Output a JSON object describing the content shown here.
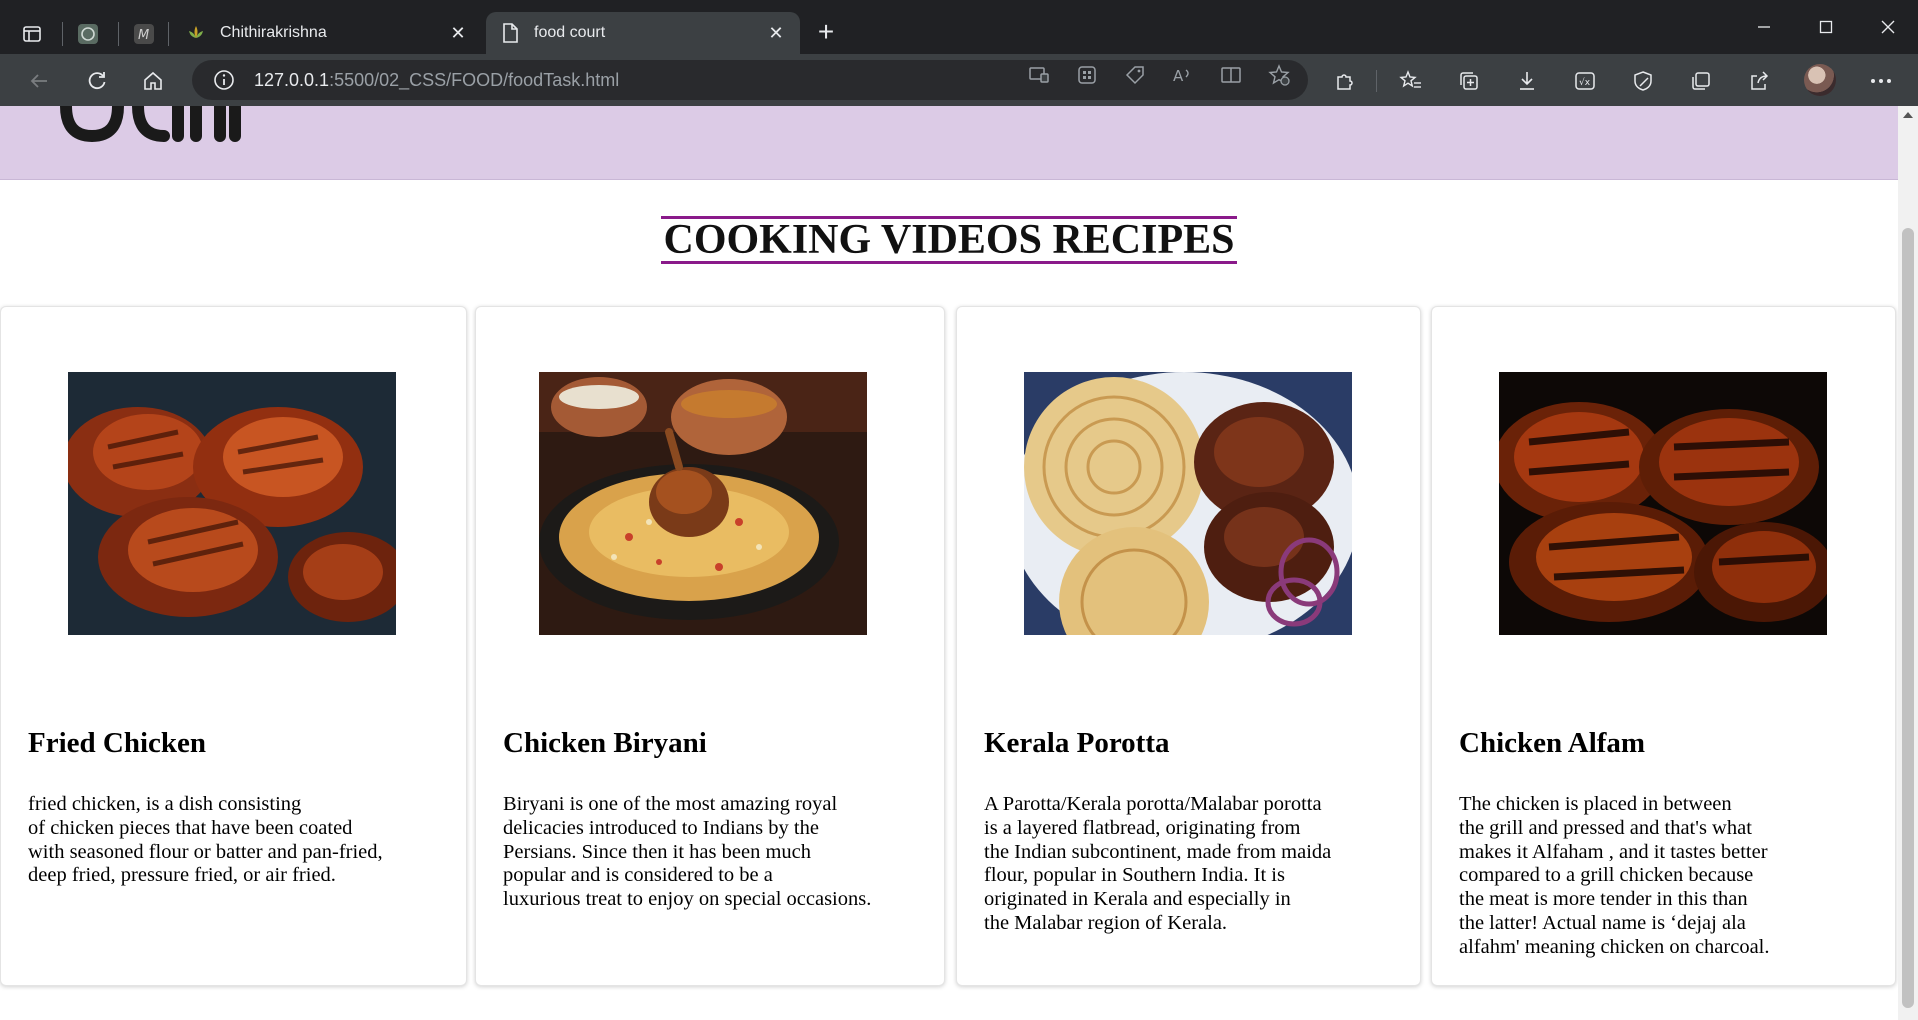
{
  "browser": {
    "tabs": [
      {
        "title": "Chithirakrishna"
      },
      {
        "title": "food court"
      }
    ],
    "url_host": "127.0.0.1",
    "url_rest": ":5500/02_CSS/FOOD/foodTask.html"
  },
  "page": {
    "section_title": "COOKING VIDEOS RECIPES",
    "header_color": "#dccbe6",
    "title_border_color": "#8a1a8a",
    "recipes": [
      {
        "name": "Fried Chicken",
        "image_icon": "fried-chicken-photo",
        "description": "fried chicken, is a dish consisting\nof chicken pieces that have been coated\nwith seasoned flour or batter and pan-fried,\ndeep fried, pressure fried, or air fried."
      },
      {
        "name": "Chicken Biryani",
        "image_icon": "chicken-biryani-photo",
        "description": "Biryani is one of the most amazing royal\ndelicacies introduced to Indians by the\nPersians. Since then it has been much\npopular and is considered to be a\nluxurious treat to enjoy on special occasions."
      },
      {
        "name": "Kerala Porotta",
        "image_icon": "kerala-porotta-photo",
        "description": "A Parotta/Kerala porotta/Malabar porotta\nis a layered flatbread, originating from\nthe Indian subcontinent, made from maida\nflour, popular in Southern India. It is\noriginated in Kerala and especially in\nthe Malabar region of Kerala."
      },
      {
        "name": "Chicken Alfam",
        "image_icon": "chicken-alfam-photo",
        "description": "The chicken is placed in between\nthe grill and pressed and that's what\nmakes it Alfaham , and it tastes better\ncompared to a grill chicken because\nthe meat is more tender in this than\nthe latter! Actual name is ‘dejaj ala\nalfahm' meaning chicken on charcoal."
      }
    ]
  }
}
